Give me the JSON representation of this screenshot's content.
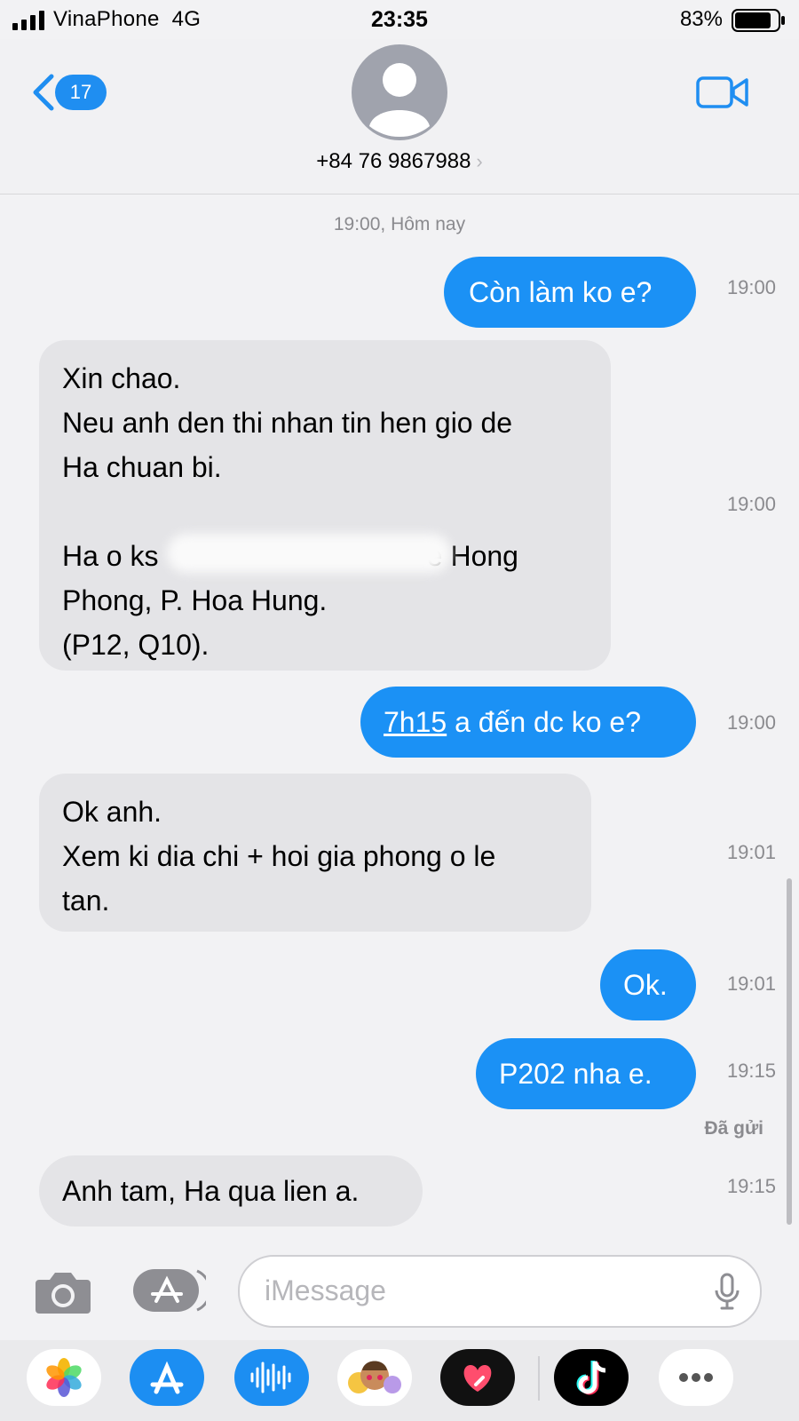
{
  "status_bar": {
    "carrier": "VinaPhone",
    "network": "4G",
    "time": "23:35",
    "battery": "83%"
  },
  "header": {
    "back_count": "17",
    "contact": "+84 76 9867988"
  },
  "conversation": {
    "date_separator": "19:00, Hôm nay",
    "messages": [
      {
        "from": "me",
        "text": "Còn làm ko e?",
        "time": "19:00"
      },
      {
        "from": "them",
        "text": "Xin chao.\nNeu anh den thi nhan tin hen gio de\nHa chuan bi.\n\nHa o ks                                  e Hong\nPhong, P. Hoa Hung.\n(P12, Q10).",
        "time": "19:00"
      },
      {
        "from": "me",
        "text_link": "7h15",
        "text_rest": " a đến dc ko e?",
        "time": "19:00"
      },
      {
        "from": "them",
        "text": "Ok anh.\nXem ki dia chi + hoi gia phong o le\ntan.",
        "time": "19:01"
      },
      {
        "from": "me",
        "text": "Ok.",
        "time": "19:01"
      },
      {
        "from": "me",
        "text": "P202 nha e.",
        "time": "19:15"
      },
      {
        "from": "them",
        "text": "Anh tam, Ha qua lien a.",
        "time": "19:15"
      }
    ],
    "delivered": "Đã gửi"
  },
  "input": {
    "placeholder": "iMessage"
  },
  "app_drawer": [
    "photos-icon",
    "app-store-icon",
    "audio-message-icon",
    "memoji-icon",
    "digital-touch-icon",
    "tiktok-icon",
    "more-icon"
  ],
  "colors": {
    "outgoing_bubble": "#1b91f5",
    "incoming_bubble": "#e4e4e7",
    "accent": "#1f8ef1"
  }
}
